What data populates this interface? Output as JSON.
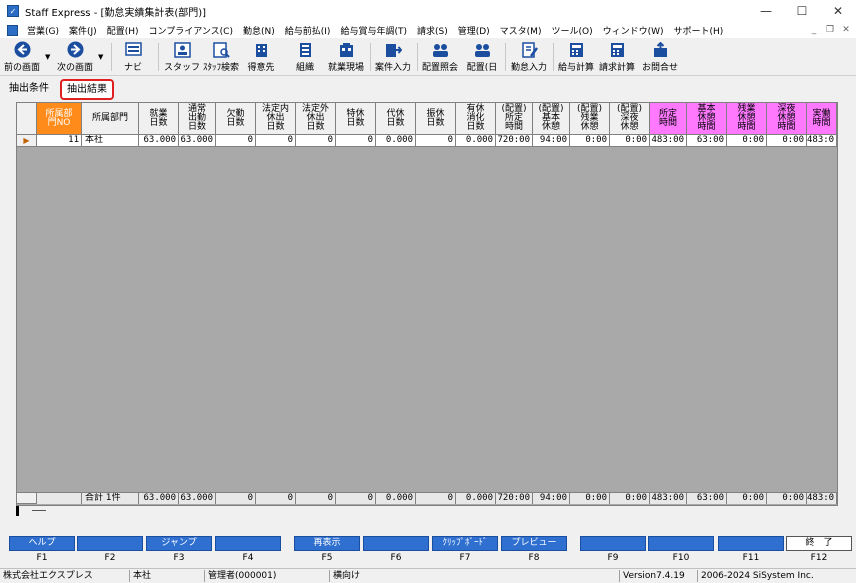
{
  "window": {
    "title": "Staff Express - [勤怠実績集計表(部門)]",
    "minimize": "—",
    "maximize": "☐",
    "close": "✕"
  },
  "menu": [
    "営業(G)",
    "案件(J)",
    "配置(H)",
    "コンプライアンス(C)",
    "勤怠(N)",
    "給与前払(I)",
    "給与賞与年調(T)",
    "請求(S)",
    "管理(D)",
    "マスタ(M)",
    "ツール(O)",
    "ウィンドウ(W)",
    "サポート(H)"
  ],
  "toolbar": {
    "prev": "前の画面",
    "next": "次の画面",
    "navi": "ナビ",
    "staff": "スタッフ",
    "staff_search": "ｽﾀｯﾌ検索",
    "client": "得意先",
    "org": "組織",
    "site": "就業現場",
    "case_input": "案件入力",
    "assign_query": "配置照会",
    "assign_day": "配置(日",
    "attendance_input": "勤怠入力",
    "salary_calc": "給与計算",
    "billing_calc": "請求計算",
    "inquiry": "お問合せ"
  },
  "tabs": {
    "conditions": "抽出条件",
    "results": "抽出結果"
  },
  "grid": {
    "columns": [
      "所属部\n門NO",
      "所属部門",
      "就業\n日数",
      "通常\n出勤\n日数",
      "欠勤\n日数",
      "法定内\n休出\n日数",
      "法定外\n休出\n日数",
      "特休\n日数",
      "代休\n日数",
      "振休\n日数",
      "有休\n消化\n日数",
      "(配置)\n所定\n時間",
      "(配置)\n基本\n休憩",
      "(配置)\n残業\n休憩",
      "(配置)\n深夜\n休憩",
      "所定\n時間",
      "基本\n休憩\n時間",
      "残業\n休憩\n時間",
      "深夜\n休憩\n時間",
      "実働\n時間"
    ],
    "row": [
      "11",
      "本社",
      "63.000",
      "63.000",
      "0",
      "0",
      "0",
      "0",
      "0.000",
      "0",
      "0.000",
      "720:00",
      "94:00",
      "0:00",
      "0:00",
      "483:00",
      "63:00",
      "0:00",
      "0:00",
      "483:0"
    ],
    "footer": [
      "",
      "合計 1件",
      "63.000",
      "63.000",
      "0",
      "0",
      "0",
      "0",
      "0.000",
      "0",
      "0.000",
      "720:00",
      "94:00",
      "0:00",
      "0:00",
      "483:00",
      "63:00",
      "0:00",
      "0:00",
      "483:0"
    ]
  },
  "fkeys": [
    {
      "key": "F1",
      "label": "ヘルプ"
    },
    {
      "key": "F2",
      "label": ""
    },
    {
      "key": "F3",
      "label": "ジャンプ"
    },
    {
      "key": "F4",
      "label": ""
    },
    {
      "key": "F5",
      "label": "再表示"
    },
    {
      "key": "F6",
      "label": ""
    },
    {
      "key": "F7",
      "label": "ｸﾘｯﾌﾟﾎﾞｰﾄﾞ"
    },
    {
      "key": "F8",
      "label": "プレビュー"
    },
    {
      "key": "F9",
      "label": ""
    },
    {
      "key": "F10",
      "label": ""
    },
    {
      "key": "F11",
      "label": ""
    },
    {
      "key": "F12",
      "label": "終　了"
    }
  ],
  "status": {
    "company": "株式会社エクスプレス",
    "branch": "本社",
    "user": "管理者(000001)",
    "orientation": "横向け",
    "version": "Version7.4.19",
    "copyright": "2006-2024 SiSystem Inc."
  }
}
